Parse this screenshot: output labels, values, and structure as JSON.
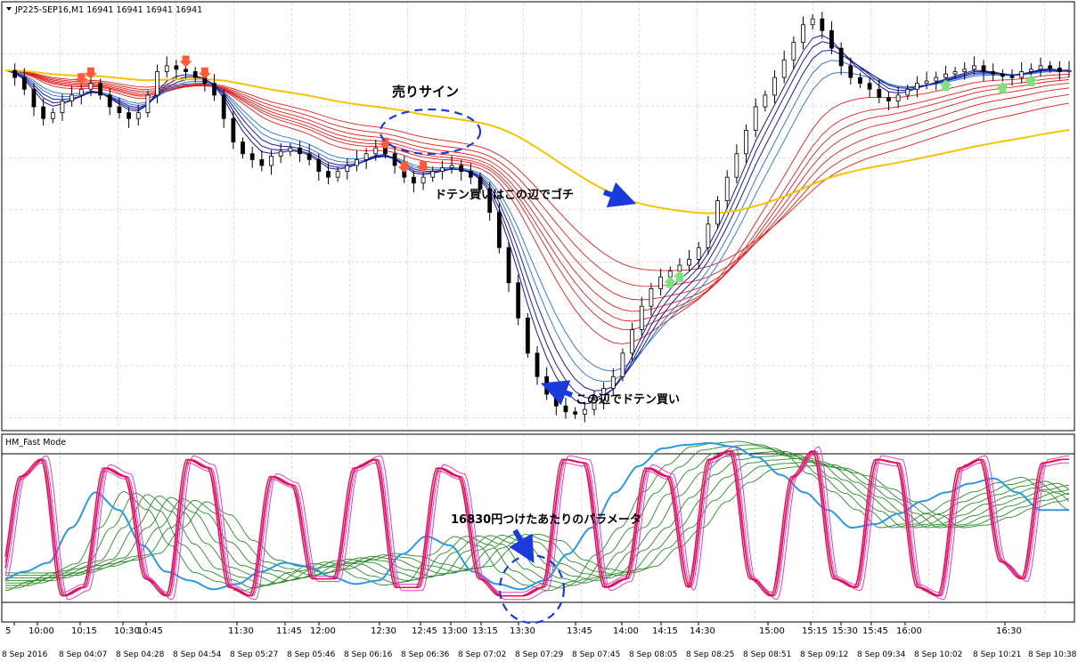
{
  "main_panel": {
    "symbol_label": "JP225-SEP16,M1  16941 16941 16941 16941",
    "collapse_icon": "triangle-down-icon"
  },
  "sub_panel": {
    "title": "HM_Fast Mode"
  },
  "annotations": {
    "sell_sign": "売りサイン",
    "doten_buy_here": "この辺でドテン買い",
    "doten_buy_gochi": "ドテン買いはこの辺でゴチ",
    "param_note": "16830円つけたあたりのパラメータ"
  },
  "time_axis": {
    "top_row": [
      "5",
      "10:00",
      "10:15",
      "10:30",
      "10:45",
      "11:30",
      "11:45",
      "12:00",
      "12:30",
      "12:45",
      "13:00",
      "13:15",
      "13:30",
      "13:45",
      "14:00",
      "14:15",
      "14:30",
      "15:00",
      "15:15",
      "15:30",
      "15:45",
      "16:00",
      "16:30"
    ],
    "bottom_row": [
      "8 Sep 2016",
      "8 Sep 04:07",
      "8 Sep 04:28",
      "8 Sep 04:54",
      "8 Sep 05:27",
      "8 Sep 05:46",
      "8 Sep 06:16",
      "8 Sep 06:36",
      "8 Sep 07:02",
      "8 Sep 07:29",
      "8 Sep 07:45",
      "8 Sep 08:05",
      "8 Sep 08:25",
      "8 Sep 08:51",
      "8 Sep 09:12",
      "8 Sep 09:34",
      "8 Sep 10:02",
      "8 Sep 10:21",
      "8 Sep 10:38"
    ]
  },
  "colors": {
    "yellow_ma": "#f5c400",
    "red_ribbon": "#e02020",
    "blue_ribbon": "#1a1aa0",
    "oscillator_magenta": "#e040c8",
    "oscillator_red": "#e0104a",
    "oscillator_green": "#2a8a2a",
    "oscillator_blue": "#2a9ae0",
    "annotation_blue": "#1a3adc",
    "grid": "#b8b8c8"
  },
  "chart_data": [
    {
      "type": "candlestick",
      "series": [
        {
          "name": "price_path",
          "values": [
            16941,
            16935,
            16925,
            16910,
            16900,
            16905,
            16915,
            16920,
            16925,
            16930,
            16920,
            16910,
            16905,
            16900,
            16905,
            16920,
            16940,
            16945,
            16942,
            16940,
            16935,
            16930,
            16920,
            16900,
            16880,
            16870,
            16865,
            16860,
            16868,
            16872,
            16875,
            16870,
            16865,
            16855,
            16850,
            16855,
            16860,
            16865,
            16870,
            16875,
            16870,
            16860,
            16850,
            16845,
            16850,
            16855,
            16858,
            16860,
            16855,
            16850,
            16840,
            16820,
            16790,
            16760,
            16730,
            16700,
            16680,
            16665,
            16655,
            16650,
            16648,
            16652,
            16660,
            16670,
            16680,
            16700,
            16720,
            16740,
            16755,
            16765,
            16770,
            16775,
            16780,
            16790,
            16810,
            16830,
            16850,
            16870,
            16890,
            16910,
            16920,
            16935,
            16950,
            16965,
            16980,
            16985,
            16975,
            16960,
            16945,
            16935,
            16930,
            16925,
            16918,
            16915,
            16920,
            16925,
            16930,
            16932,
            16935,
            16938,
            16940,
            16942,
            16945,
            16940,
            16938,
            16936,
            16935,
            16940,
            16942,
            16945,
            16943,
            16940,
            16941
          ]
        }
      ]
    },
    {
      "type": "line",
      "series": [
        {
          "name": "fast",
          "values": [
            20,
            80,
            90,
            10,
            15,
            85,
            80,
            20,
            10,
            90,
            85,
            15,
            10,
            80,
            75,
            20,
            20,
            85,
            90,
            15,
            15,
            85,
            80,
            20,
            10,
            10,
            15,
            90,
            88,
            15,
            20,
            85,
            80,
            15,
            90,
            95,
            20,
            10,
            80,
            95,
            20,
            15,
            90,
            88,
            15,
            10,
            85,
            90,
            30,
            20,
            88,
            90
          ]
        },
        {
          "name": "slow",
          "values": [
            15,
            20,
            25,
            30,
            50,
            70,
            60,
            40,
            25,
            20,
            15,
            18,
            25,
            30,
            28,
            22,
            18,
            20,
            35,
            45,
            40,
            25,
            18,
            15,
            20,
            35,
            50,
            70,
            85,
            95,
            97,
            98,
            96,
            90,
            80,
            70,
            60,
            50,
            52,
            58,
            65,
            70,
            75,
            78,
            70,
            60
          ]
        }
      ]
    }
  ]
}
